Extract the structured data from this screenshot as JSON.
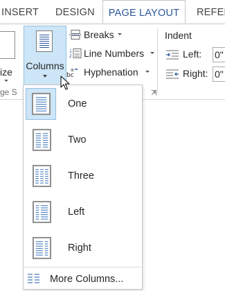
{
  "tabs": [
    {
      "id": "insert",
      "label": "INSERT",
      "active": false
    },
    {
      "id": "design",
      "label": "DESIGN",
      "active": false
    },
    {
      "id": "page-layout",
      "label": "PAGE LAYOUT",
      "active": true
    },
    {
      "id": "references",
      "label": "REFER",
      "active": false
    }
  ],
  "ribbon": {
    "size_label": "ize",
    "group_label_left": "ge S",
    "columns_label": "Columns",
    "breaks_label": "Breaks",
    "line_numbers_label": "Line Numbers",
    "hyphenation_label": "Hyphenation",
    "indent_title": "Indent",
    "indent_left_label": "Left:",
    "indent_right_label": "Right:",
    "indent_left_value": "0\"",
    "indent_right_value": "0\""
  },
  "columns_menu": {
    "items": [
      {
        "label": "One",
        "selected": true
      },
      {
        "label": "Two",
        "selected": false
      },
      {
        "label": "Three",
        "selected": false
      },
      {
        "label": "Left",
        "selected": false
      },
      {
        "label": "Right",
        "selected": false
      }
    ],
    "more_label": "More Columns..."
  },
  "colors": {
    "accent": "#2b579a",
    "hover_fill": "#cde6f7",
    "hover_border": "#92c0e0",
    "icon_blue": "#4a7fc1"
  }
}
